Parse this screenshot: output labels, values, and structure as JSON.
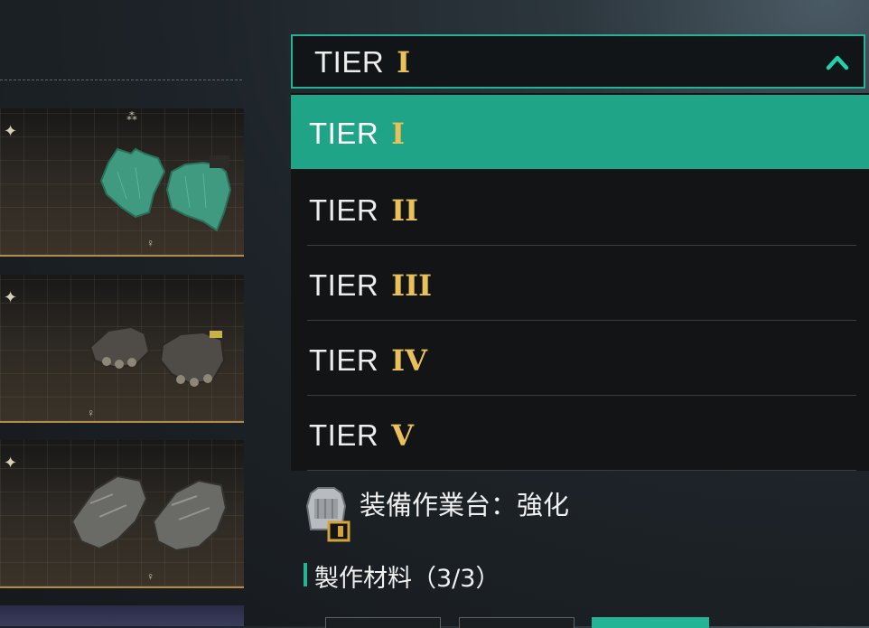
{
  "dropdown": {
    "selected": {
      "word": "TIER",
      "numeral": "I"
    },
    "options": [
      {
        "word": "TIER",
        "numeral": "I",
        "selected": true
      },
      {
        "word": "TIER",
        "numeral": "II",
        "selected": false
      },
      {
        "word": "TIER",
        "numeral": "III",
        "selected": false
      },
      {
        "word": "TIER",
        "numeral": "IV",
        "selected": false
      },
      {
        "word": "TIER",
        "numeral": "V",
        "selected": false
      }
    ]
  },
  "crafting": {
    "bench_label": "装備作業台：強化",
    "materials_label": "製作材料（3/3）"
  },
  "colors": {
    "accent": "#22b494",
    "selected_row": "#1fa488",
    "numeral": "#e8c15a"
  },
  "icons": {
    "collapse": "chevron-up-icon",
    "bench": "equipment-bench-icon"
  }
}
